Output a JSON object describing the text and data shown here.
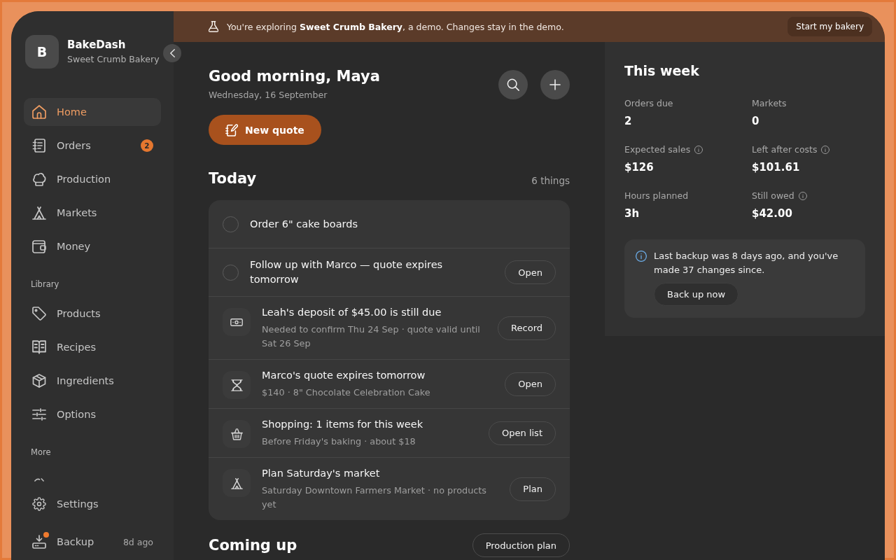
{
  "banner": {
    "message": "You're exploring **Sweet Crumb Bakery**, a demo. Changes stay in the demo.",
    "action": "Start my bakery"
  },
  "sidebar": {
    "logo_letter": "B",
    "app_name": "BakeDash",
    "business_name": "Sweet Crumb Bakery",
    "sections": [
      {
        "items": [
          {
            "label": "Home",
            "selected": true,
            "alert": false
          },
          {
            "label": "Orders",
            "selected": false,
            "alert": false,
            "badge": "2"
          },
          {
            "label": "Production",
            "selected": false,
            "alert": false
          },
          {
            "label": "Markets",
            "selected": false,
            "alert": false
          },
          {
            "label": "Money",
            "selected": false,
            "alert": false
          }
        ]
      },
      {
        "title": "Library",
        "items": [
          {
            "label": "Products",
            "selected": false,
            "alert": false
          },
          {
            "label": "Recipes",
            "selected": false,
            "alert": false
          },
          {
            "label": "Ingredients",
            "selected": false,
            "alert": false
          },
          {
            "label": "Options",
            "selected": false,
            "alert": false
          }
        ]
      },
      {
        "title": "More",
        "items": [
          {
            "label": "Settings",
            "selected": false,
            "alert": false
          },
          {
            "label": "Backup",
            "selected": false,
            "alert": true,
            "meta": "8d ago"
          }
        ]
      }
    ]
  },
  "header": {
    "greeting": "Good morning, Maya",
    "date": "Wednesday, 16 September",
    "primary_action": "New quote"
  },
  "today": {
    "title": "Today",
    "count": "6 things",
    "tasks": [
      {
        "kind": "todo",
        "title": "Order 6\" cake boards",
        "done": false
      },
      {
        "kind": "todo",
        "title": "Follow up with Marco — quote expires tomorrow",
        "done": false,
        "action": "Open"
      },
      {
        "kind": "reminder",
        "title": "Leah's deposit of $45.00 is still due",
        "detail": "Needed to confirm Thu 24 Sep · quote valid until Sat 26 Sep",
        "action": "Record"
      },
      {
        "kind": "reminder",
        "title": "Marco's quote expires tomorrow",
        "detail": "$140 · 8\" Chocolate Celebration Cake",
        "action": "Open"
      },
      {
        "kind": "reminder",
        "title": "Shopping: 1 items for this week",
        "detail": "Before Friday's baking · about $18",
        "action": "Open list"
      },
      {
        "kind": "reminder",
        "title": "Plan Saturday's market",
        "detail": "Saturday Downtown Farmers Market · no products yet",
        "action": "Plan"
      }
    ]
  },
  "coming_up": {
    "title": "Coming up",
    "action": "Production plan"
  },
  "this_week": {
    "title": "This week",
    "stats": [
      {
        "label": "Orders due",
        "value": "2",
        "info": false
      },
      {
        "label": "Markets",
        "value": "0",
        "info": false
      },
      {
        "label": "Expected sales",
        "value": "$126",
        "info": true
      },
      {
        "label": "Left after costs",
        "value": "$101.61",
        "info": true
      },
      {
        "label": "Hours planned",
        "value": "3h",
        "info": false
      },
      {
        "label": "Still owed",
        "value": "$42.00",
        "info": true
      }
    ],
    "notice": {
      "message": "Last backup was 8 days ago, and you've made 37 changes since.",
      "action": "Back up now"
    }
  }
}
